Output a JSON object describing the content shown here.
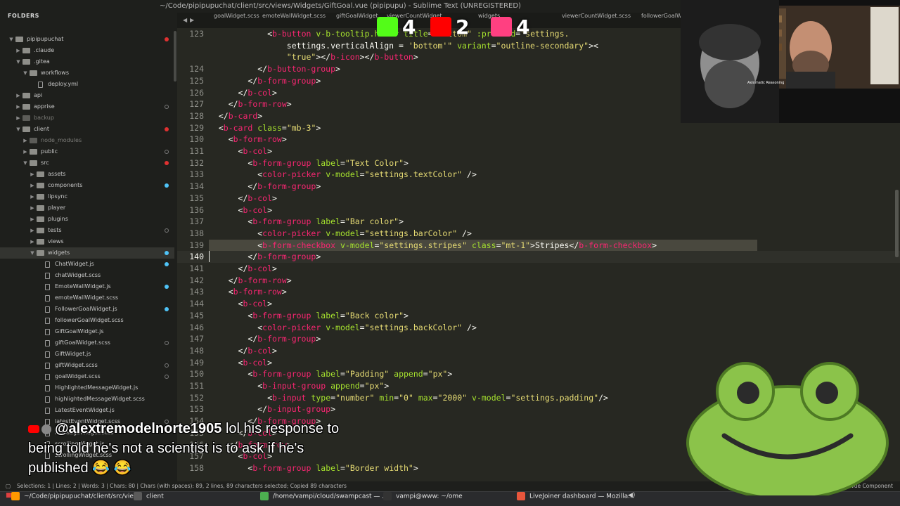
{
  "window_title": "~/Code/pipipupuchat/client/src/views/Widgets/GiftGoal.vue (pipipupu) - Sublime Text (UNREGISTERED)",
  "sidebar": {
    "header": "FOLDERS",
    "items": [
      {
        "label": "pipipupuchat",
        "type": "folder",
        "depth": 0,
        "open": true,
        "dot": "red"
      },
      {
        "label": ".claude",
        "type": "folder",
        "depth": 1,
        "open": false,
        "dot": ""
      },
      {
        "label": ".gitea",
        "type": "folder",
        "depth": 1,
        "open": true,
        "dot": ""
      },
      {
        "label": "workflows",
        "type": "folder",
        "depth": 2,
        "open": true,
        "dot": ""
      },
      {
        "label": "deploy.yml",
        "type": "file",
        "depth": 3,
        "dot": ""
      },
      {
        "label": "api",
        "type": "folder",
        "depth": 1,
        "open": false,
        "dot": ""
      },
      {
        "label": "apprise",
        "type": "folder",
        "depth": 1,
        "open": false,
        "dot": "ring"
      },
      {
        "label": "backup",
        "type": "folder",
        "depth": 1,
        "open": false,
        "dot": "",
        "dim": true
      },
      {
        "label": "client",
        "type": "folder",
        "depth": 1,
        "open": true,
        "dot": "red"
      },
      {
        "label": "node_modules",
        "type": "folder",
        "depth": 2,
        "open": false,
        "dot": "",
        "dim": true
      },
      {
        "label": "public",
        "type": "folder",
        "depth": 2,
        "open": false,
        "dot": "ring"
      },
      {
        "label": "src",
        "type": "folder",
        "depth": 2,
        "open": true,
        "dot": "red"
      },
      {
        "label": "assets",
        "type": "folder",
        "depth": 3,
        "open": false,
        "dot": ""
      },
      {
        "label": "components",
        "type": "folder",
        "depth": 3,
        "open": false,
        "dot": "blue"
      },
      {
        "label": "lipsync",
        "type": "folder",
        "depth": 3,
        "open": false,
        "dot": ""
      },
      {
        "label": "player",
        "type": "folder",
        "depth": 3,
        "open": false,
        "dot": ""
      },
      {
        "label": "plugins",
        "type": "folder",
        "depth": 3,
        "open": false,
        "dot": ""
      },
      {
        "label": "tests",
        "type": "folder",
        "depth": 3,
        "open": false,
        "dot": "ring"
      },
      {
        "label": "views",
        "type": "folder",
        "depth": 3,
        "open": false,
        "dot": ""
      },
      {
        "label": "widgets",
        "type": "folder",
        "depth": 3,
        "open": true,
        "dot": "blue",
        "selected": true
      },
      {
        "label": "ChatWidget.js",
        "type": "file",
        "depth": 4,
        "dot": "blue"
      },
      {
        "label": "chatWidget.scss",
        "type": "file",
        "depth": 4,
        "dot": ""
      },
      {
        "label": "EmoteWallWidget.js",
        "type": "file",
        "depth": 4,
        "dot": "blue"
      },
      {
        "label": "emoteWallWidget.scss",
        "type": "file",
        "depth": 4,
        "dot": ""
      },
      {
        "label": "FollowerGoalWidget.js",
        "type": "file",
        "depth": 4,
        "dot": "blue"
      },
      {
        "label": "followerGoalWidget.scss",
        "type": "file",
        "depth": 4,
        "dot": ""
      },
      {
        "label": "GiftGoalWidget.js",
        "type": "file",
        "depth": 4,
        "dot": ""
      },
      {
        "label": "giftGoalWidget.scss",
        "type": "file",
        "depth": 4,
        "dot": "ring"
      },
      {
        "label": "GiftWidget.js",
        "type": "file",
        "depth": 4,
        "dot": ""
      },
      {
        "label": "giftWidget.scss",
        "type": "file",
        "depth": 4,
        "dot": "ring"
      },
      {
        "label": "goalWidget.scss",
        "type": "file",
        "depth": 4,
        "dot": "ring"
      },
      {
        "label": "HighlightedMessageWidget.js",
        "type": "file",
        "depth": 4,
        "dot": ""
      },
      {
        "label": "highlightedMessageWidget.scss",
        "type": "file",
        "depth": 4,
        "dot": ""
      },
      {
        "label": "LatestEventWidget.js",
        "type": "file",
        "depth": 4,
        "dot": ""
      },
      {
        "label": "latestEventWidget.scss",
        "type": "file",
        "depth": 4,
        "dot": "ring"
      },
      {
        "label": "messageWidget.scss",
        "type": "file",
        "depth": 4,
        "dot": ""
      },
      {
        "label": "scrollingWidget.js",
        "type": "file",
        "depth": 4,
        "dot": ""
      },
      {
        "label": "scrollingWidget.scss",
        "type": "file",
        "depth": 4,
        "dot": ""
      }
    ]
  },
  "tabs": {
    "nav_prev": "◀",
    "nav_next": "▶",
    "items": [
      "goalWidget.scss",
      "emoteWallWidget.scss",
      "giftGoalWidget",
      "viewerCountWidget",
      "widgets",
      "viewerCountWidget.scss",
      "followerGoalWi"
    ]
  },
  "editor": {
    "current_line": 140,
    "lines": [
      {
        "n": 123,
        "html": "            <span class='pc'>&lt;</span><span class='tg'>b-button</span> <span class='at'>v-b-tooltip.hover</span> <span class='at'>title</span>=<span class='st'>\"Bottom\"</span> <span class='at'>:pressed</span>=<span class='st'>\"settings.</span>"
      },
      {
        "n": null,
        "html": "                settings.verticalAlign = <span class='st'>'bottom'\"</span> <span class='at'>variant</span>=<span class='st'>\"outline-secondary\"</span>&gt;&lt;"
      },
      {
        "n": null,
        "html": "                <span class='st'>\"true\"</span>&gt;&lt;/<span class='tg'>b-icon</span>&gt;&lt;/<span class='tg'>b-button</span>&gt;"
      },
      {
        "n": 124,
        "html": "          &lt;/<span class='tg'>b-button-group</span>&gt;"
      },
      {
        "n": 125,
        "html": "        &lt;/<span class='tg'>b-form-group</span>&gt;"
      },
      {
        "n": 126,
        "html": "      &lt;/<span class='tg'>b-col</span>&gt;"
      },
      {
        "n": 127,
        "html": "    &lt;/<span class='tg'>b-form-row</span>&gt;"
      },
      {
        "n": 128,
        "html": "  &lt;/<span class='tg'>b-card</span>&gt;"
      },
      {
        "n": 129,
        "html": "  &lt;<span class='tg'>b-card</span> <span class='at'>class</span>=<span class='st'>\"mb-3\"</span>&gt;"
      },
      {
        "n": 130,
        "html": "    &lt;<span class='tg'>b-form-row</span>&gt;"
      },
      {
        "n": 131,
        "html": "      &lt;<span class='tg'>b-col</span>&gt;"
      },
      {
        "n": 132,
        "html": "        &lt;<span class='tg'>b-form-group</span> <span class='at'>label</span>=<span class='st'>\"Text Color\"</span>&gt;"
      },
      {
        "n": 133,
        "html": "          &lt;<span class='tg'>color-picker</span> <span class='at'>v-model</span>=<span class='st'>\"settings.textColor\"</span> /&gt;"
      },
      {
        "n": 134,
        "html": "        &lt;/<span class='tg'>b-form-group</span>&gt;"
      },
      {
        "n": 135,
        "html": "      &lt;/<span class='tg'>b-col</span>&gt;"
      },
      {
        "n": 136,
        "html": "      &lt;<span class='tg'>b-col</span>&gt;"
      },
      {
        "n": 137,
        "html": "        &lt;<span class='tg'>b-form-group</span> <span class='at'>label</span>=<span class='st'>\"Bar color\"</span>&gt;"
      },
      {
        "n": 138,
        "html": "          &lt;<span class='tg'>color-picker</span> <span class='at'>v-model</span>=<span class='st'>\"settings.barColor\"</span> /&gt;"
      },
      {
        "n": 139,
        "html": "          &lt;<span class='tg'>b-form-checkbox</span> <span class='at'>v-model</span>=<span class='st'>\"settings.stripes\"</span> <span class='at'>class</span>=<span class='st'>\"mt-1\"</span>&gt;Stripes&lt;/<span class='tg'>b-form-checkbox</span>&gt;",
        "sel": true
      },
      {
        "n": 140,
        "html": "        &lt;/<span class='tg'>b-form-group</span>&gt;"
      },
      {
        "n": 141,
        "html": "      &lt;/<span class='tg'>b-col</span>&gt;"
      },
      {
        "n": 142,
        "html": "    &lt;/<span class='tg'>b-form-row</span>&gt;"
      },
      {
        "n": 143,
        "html": "    &lt;<span class='tg'>b-form-row</span>&gt;"
      },
      {
        "n": 144,
        "html": "      &lt;<span class='tg'>b-col</span>&gt;"
      },
      {
        "n": 145,
        "html": "        &lt;<span class='tg'>b-form-group</span> <span class='at'>label</span>=<span class='st'>\"Back color\"</span>&gt;"
      },
      {
        "n": 146,
        "html": "          &lt;<span class='tg'>color-picker</span> <span class='at'>v-model</span>=<span class='st'>\"settings.backColor\"</span> /&gt;"
      },
      {
        "n": 147,
        "html": "        &lt;/<span class='tg'>b-form-group</span>&gt;"
      },
      {
        "n": 148,
        "html": "      &lt;/<span class='tg'>b-col</span>&gt;"
      },
      {
        "n": 149,
        "html": "      &lt;<span class='tg'>b-col</span>&gt;"
      },
      {
        "n": 150,
        "html": "        &lt;<span class='tg'>b-form-group</span> <span class='at'>label</span>=<span class='st'>\"Padding\"</span> <span class='at'>append</span>=<span class='st'>\"px\"</span>&gt;"
      },
      {
        "n": 151,
        "html": "          &lt;<span class='tg'>b-input-group</span> <span class='at'>append</span>=<span class='st'>\"px\"</span>&gt;"
      },
      {
        "n": 152,
        "html": "            &lt;<span class='tg'>b-input</span> <span class='at'>type</span>=<span class='st'>\"number\"</span> <span class='at'>min</span>=<span class='st'>\"0\"</span> <span class='at'>max</span>=<span class='st'>\"2000\"</span> <span class='at'>v-model</span>=<span class='st'>\"settings.padding\"</span>/&gt;"
      },
      {
        "n": 153,
        "html": "          &lt;/<span class='tg'>b-input-group</span>&gt;"
      },
      {
        "n": 154,
        "html": "        &lt;/<span class='tg'>b-form-group</span>&gt;"
      },
      {
        "n": 155,
        "html": "      &lt;/<span class='tg'>b-col</span>&gt;"
      },
      {
        "n": 156,
        "html": "    &lt;/<span class='tg'>b-form-row</span>&gt;"
      },
      {
        "n": 157,
        "html": "      &lt;<span class='tg'>b-col</span>&gt;"
      },
      {
        "n": 158,
        "html": "        &lt;<span class='tg'>b-form-group</span> <span class='at'>label</span>=<span class='st'>\"Border width\"</span>&gt;"
      }
    ]
  },
  "statusbar": {
    "left": "Selections: 1 | Lines: 2 | Words: 3 | Chars: 80 | Chars (with spaces): 89, 2 lines, 89 characters selected; Copied 89 characters",
    "right": "Vue Component"
  },
  "taskbar": {
    "items": [
      {
        "label": "~/Code/pipipupuchat/client/src/vie...",
        "color": "#ff9800"
      },
      {
        "label": "client",
        "color": "#5a5a5a"
      },
      {
        "label": "/home/vampi/cloud/swampcast — ...",
        "color": "#4caf50"
      },
      {
        "label": "vampi@www: ~/ome",
        "color": "#333"
      },
      {
        "label": "LiveJoiner dashboard — Mozilla...",
        "color": "#e8563c"
      }
    ]
  },
  "overlay": {
    "stats": [
      {
        "icon": "kick-icon",
        "count": "4",
        "color": "#53fc18"
      },
      {
        "icon": "youtube-icon",
        "count": "2",
        "color": "#ff0000"
      },
      {
        "icon": "pill-icon",
        "count": "4",
        "color": "#ff4081"
      }
    ],
    "chat": {
      "username": "@alextremodelnorte1905",
      "message": " lol his response to being told he's not a scientist is to ask if he's published 😂 😂"
    },
    "webcam_caption": "Axiomatic Reasoning"
  }
}
